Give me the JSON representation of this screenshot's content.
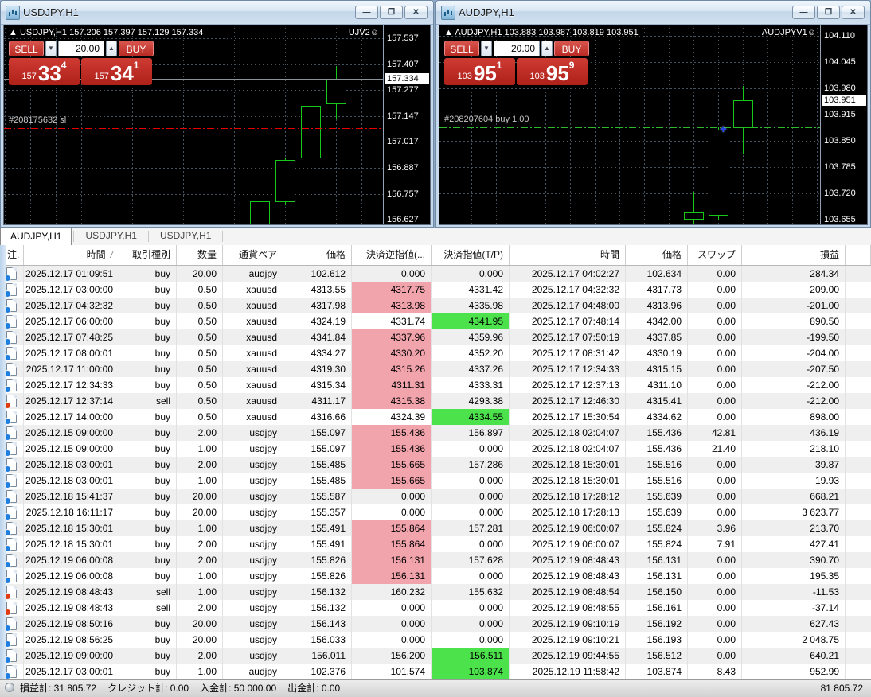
{
  "icons": {
    "minimize": "—",
    "restore": "❐",
    "close": "✕",
    "spin_down": "▼",
    "spin_up": "▲",
    "smiley": "☺",
    "collapse_arrow": "▲",
    "sort": "/",
    "move_cursor": "+"
  },
  "colors": {
    "candle": "#18c818",
    "sl_line": "#e80000",
    "buy_line": "#2eb82e",
    "current_line": "#8a929a",
    "pink_cell": "#f2a4ac",
    "green_cell": "#4ce24c",
    "button_red": "#c0392b"
  },
  "windows": [
    {
      "title": "USDJPY,H1",
      "chart_header": "USDJPY,H1 157.206 157.397 157.129 157.334",
      "ea_label": "UJV2",
      "panel": {
        "sell_label": "SELL",
        "buy_label": "BUY",
        "volume": "20.00",
        "sell_prefix": "157",
        "sell_big": "33",
        "sell_sup": "4",
        "buy_prefix": "157",
        "buy_big": "34",
        "buy_sup": "1"
      }
    },
    {
      "title": "AUDJPY,H1",
      "chart_header": "AUDJPY,H1 103.883 103.987 103.819 103.951",
      "ea_label": "AUDJPYV1",
      "panel": {
        "sell_label": "SELL",
        "buy_label": "BUY",
        "volume": "20.00",
        "sell_prefix": "103",
        "sell_big": "95",
        "sell_sup": "1",
        "buy_prefix": "103",
        "buy_big": "95",
        "buy_sup": "9"
      }
    }
  ],
  "chart_data": [
    {
      "type": "candlestick",
      "title": "USDJPY,H1",
      "last_bar_ohlc": {
        "open": 157.206,
        "high": 157.397,
        "low": 157.129,
        "close": 157.334
      },
      "ylim": [
        156.604,
        157.601
      ],
      "y_ticks": [
        157.537,
        157.407,
        157.277,
        157.147,
        157.017,
        156.887,
        156.757,
        156.627
      ],
      "current_price": 157.334,
      "grid": {
        "offset": 1,
        "step": 32
      },
      "candles": [
        {
          "x": 321,
          "o": 156.605,
          "h": 156.735,
          "l": 156.59,
          "c": 156.72
        },
        {
          "x": 353,
          "o": 156.715,
          "h": 156.94,
          "l": 156.7,
          "c": 156.928
        },
        {
          "x": 385,
          "o": 156.935,
          "h": 157.21,
          "l": 156.84,
          "c": 157.2
        },
        {
          "x": 417,
          "o": 157.206,
          "h": 157.397,
          "l": 157.129,
          "c": 157.334
        }
      ],
      "lines": [
        {
          "price": 157.334,
          "style": "solid",
          "color": "#8a929a",
          "label": ""
        },
        {
          "price": 157.087,
          "style": "dashdot",
          "color": "#e80000",
          "label": "#208175632 sl"
        }
      ]
    },
    {
      "type": "candlestick",
      "title": "AUDJPY,H1",
      "last_bar_ohlc": {
        "open": 103.883,
        "high": 103.987,
        "low": 103.819,
        "close": 103.951
      },
      "ylim": [
        103.644,
        104.136
      ],
      "y_ticks": [
        104.11,
        104.045,
        103.98,
        103.915,
        103.85,
        103.785,
        103.72,
        103.655
      ],
      "current_price": 103.951,
      "grid": {
        "offset": 9,
        "step": 31
      },
      "candles": [
        {
          "x": 319,
          "o": 103.655,
          "h": 103.725,
          "l": 103.647,
          "c": 103.673
        },
        {
          "x": 350,
          "o": 103.666,
          "h": 103.886,
          "l": 103.654,
          "c": 103.879
        },
        {
          "x": 381,
          "o": 103.883,
          "h": 103.987,
          "l": 103.819,
          "c": 103.951
        }
      ],
      "lines": [
        {
          "price": 103.885,
          "style": "dashdot",
          "color": "#2eb82e",
          "label": "#208207604 buy 1.00"
        }
      ],
      "cursor": {
        "x": 352,
        "y": 124
      }
    }
  ],
  "tabs": [
    {
      "label": "AUDJPY,H1",
      "active": true
    },
    {
      "label": "USDJPY,H1",
      "active": false
    },
    {
      "label": "USDJPY,H1",
      "active": false
    }
  ],
  "table": {
    "headers": [
      "注.",
      "時間",
      "取引種別",
      "数量",
      "通貨ペア",
      "価格",
      "決済逆指値(...",
      "決済指値(T/P)",
      "時間",
      "価格",
      "スワップ",
      "損益"
    ],
    "rows": [
      {
        "icon": "buy",
        "open_time": "2025.12.17 01:09:51",
        "type": "buy",
        "volume": "20.00",
        "symbol": "audjpy",
        "price": "102.612",
        "sl": "0.000",
        "tp": "0.000",
        "close_time": "2025.12.17 04:02:27",
        "close_price": "102.634",
        "swap": "0.00",
        "profit": "284.34",
        "sl_hl": "",
        "tp_hl": ""
      },
      {
        "icon": "buy",
        "open_time": "2025.12.17 03:00:00",
        "type": "buy",
        "volume": "0.50",
        "symbol": "xauusd",
        "price": "4313.55",
        "sl": "4317.75",
        "tp": "4331.42",
        "close_time": "2025.12.17 04:32:32",
        "close_price": "4317.73",
        "swap": "0.00",
        "profit": "209.00",
        "sl_hl": "pink",
        "tp_hl": ""
      },
      {
        "icon": "buy",
        "open_time": "2025.12.17 04:32:32",
        "type": "buy",
        "volume": "0.50",
        "symbol": "xauusd",
        "price": "4317.98",
        "sl": "4313.98",
        "tp": "4335.98",
        "close_time": "2025.12.17 04:48:00",
        "close_price": "4313.96",
        "swap": "0.00",
        "profit": "-201.00",
        "sl_hl": "pink",
        "tp_hl": ""
      },
      {
        "icon": "buy",
        "open_time": "2025.12.17 06:00:00",
        "type": "buy",
        "volume": "0.50",
        "symbol": "xauusd",
        "price": "4324.19",
        "sl": "4331.74",
        "tp": "4341.95",
        "close_time": "2025.12.17 07:48:14",
        "close_price": "4342.00",
        "swap": "0.00",
        "profit": "890.50",
        "sl_hl": "",
        "tp_hl": "green"
      },
      {
        "icon": "buy",
        "open_time": "2025.12.17 07:48:25",
        "type": "buy",
        "volume": "0.50",
        "symbol": "xauusd",
        "price": "4341.84",
        "sl": "4337.96",
        "tp": "4359.96",
        "close_time": "2025.12.17 07:50:19",
        "close_price": "4337.85",
        "swap": "0.00",
        "profit": "-199.50",
        "sl_hl": "pink",
        "tp_hl": ""
      },
      {
        "icon": "buy",
        "open_time": "2025.12.17 08:00:01",
        "type": "buy",
        "volume": "0.50",
        "symbol": "xauusd",
        "price": "4334.27",
        "sl": "4330.20",
        "tp": "4352.20",
        "close_time": "2025.12.17 08:31:42",
        "close_price": "4330.19",
        "swap": "0.00",
        "profit": "-204.00",
        "sl_hl": "pink",
        "tp_hl": ""
      },
      {
        "icon": "buy",
        "open_time": "2025.12.17 11:00:00",
        "type": "buy",
        "volume": "0.50",
        "symbol": "xauusd",
        "price": "4319.30",
        "sl": "4315.26",
        "tp": "4337.26",
        "close_time": "2025.12.17 12:34:33",
        "close_price": "4315.15",
        "swap": "0.00",
        "profit": "-207.50",
        "sl_hl": "pink",
        "tp_hl": ""
      },
      {
        "icon": "buy",
        "open_time": "2025.12.17 12:34:33",
        "type": "buy",
        "volume": "0.50",
        "symbol": "xauusd",
        "price": "4315.34",
        "sl": "4311.31",
        "tp": "4333.31",
        "close_time": "2025.12.17 12:37:13",
        "close_price": "4311.10",
        "swap": "0.00",
        "profit": "-212.00",
        "sl_hl": "pink",
        "tp_hl": ""
      },
      {
        "icon": "sell",
        "open_time": "2025.12.17 12:37:14",
        "type": "sell",
        "volume": "0.50",
        "symbol": "xauusd",
        "price": "4311.17",
        "sl": "4315.38",
        "tp": "4293.38",
        "close_time": "2025.12.17 12:46:30",
        "close_price": "4315.41",
        "swap": "0.00",
        "profit": "-212.00",
        "sl_hl": "pink",
        "tp_hl": ""
      },
      {
        "icon": "buy",
        "open_time": "2025.12.17 14:00:00",
        "type": "buy",
        "volume": "0.50",
        "symbol": "xauusd",
        "price": "4316.66",
        "sl": "4324.39",
        "tp": "4334.55",
        "close_time": "2025.12.17 15:30:54",
        "close_price": "4334.62",
        "swap": "0.00",
        "profit": "898.00",
        "sl_hl": "",
        "tp_hl": "green"
      },
      {
        "icon": "buy",
        "open_time": "2025.12.15 09:00:00",
        "type": "buy",
        "volume": "2.00",
        "symbol": "usdjpy",
        "price": "155.097",
        "sl": "155.436",
        "tp": "156.897",
        "close_time": "2025.12.18 02:04:07",
        "close_price": "155.436",
        "swap": "42.81",
        "profit": "436.19",
        "sl_hl": "pink",
        "tp_hl": ""
      },
      {
        "icon": "buy",
        "open_time": "2025.12.15 09:00:00",
        "type": "buy",
        "volume": "1.00",
        "symbol": "usdjpy",
        "price": "155.097",
        "sl": "155.436",
        "tp": "0.000",
        "close_time": "2025.12.18 02:04:07",
        "close_price": "155.436",
        "swap": "21.40",
        "profit": "218.10",
        "sl_hl": "pink",
        "tp_hl": ""
      },
      {
        "icon": "buy",
        "open_time": "2025.12.18 03:00:01",
        "type": "buy",
        "volume": "2.00",
        "symbol": "usdjpy",
        "price": "155.485",
        "sl": "155.665",
        "tp": "157.286",
        "close_time": "2025.12.18 15:30:01",
        "close_price": "155.516",
        "swap": "0.00",
        "profit": "39.87",
        "sl_hl": "pink",
        "tp_hl": ""
      },
      {
        "icon": "buy",
        "open_time": "2025.12.18 03:00:01",
        "type": "buy",
        "volume": "1.00",
        "symbol": "usdjpy",
        "price": "155.485",
        "sl": "155.665",
        "tp": "0.000",
        "close_time": "2025.12.18 15:30:01",
        "close_price": "155.516",
        "swap": "0.00",
        "profit": "19.93",
        "sl_hl": "pink",
        "tp_hl": ""
      },
      {
        "icon": "buy",
        "open_time": "2025.12.18 15:41:37",
        "type": "buy",
        "volume": "20.00",
        "symbol": "usdjpy",
        "price": "155.587",
        "sl": "0.000",
        "tp": "0.000",
        "close_time": "2025.12.18 17:28:12",
        "close_price": "155.639",
        "swap": "0.00",
        "profit": "668.21",
        "sl_hl": "",
        "tp_hl": ""
      },
      {
        "icon": "buy",
        "open_time": "2025.12.18 16:11:17",
        "type": "buy",
        "volume": "20.00",
        "symbol": "usdjpy",
        "price": "155.357",
        "sl": "0.000",
        "tp": "0.000",
        "close_time": "2025.12.18 17:28:13",
        "close_price": "155.639",
        "swap": "0.00",
        "profit": "3 623.77",
        "sl_hl": "",
        "tp_hl": ""
      },
      {
        "icon": "buy",
        "open_time": "2025.12.18 15:30:01",
        "type": "buy",
        "volume": "1.00",
        "symbol": "usdjpy",
        "price": "155.491",
        "sl": "155.864",
        "tp": "157.281",
        "close_time": "2025.12.19 06:00:07",
        "close_price": "155.824",
        "swap": "3.96",
        "profit": "213.70",
        "sl_hl": "pink",
        "tp_hl": ""
      },
      {
        "icon": "buy",
        "open_time": "2025.12.18 15:30:01",
        "type": "buy",
        "volume": "2.00",
        "symbol": "usdjpy",
        "price": "155.491",
        "sl": "155.864",
        "tp": "0.000",
        "close_time": "2025.12.19 06:00:07",
        "close_price": "155.824",
        "swap": "7.91",
        "profit": "427.41",
        "sl_hl": "pink",
        "tp_hl": ""
      },
      {
        "icon": "buy",
        "open_time": "2025.12.19 06:00:08",
        "type": "buy",
        "volume": "2.00",
        "symbol": "usdjpy",
        "price": "155.826",
        "sl": "156.131",
        "tp": "157.628",
        "close_time": "2025.12.19 08:48:43",
        "close_price": "156.131",
        "swap": "0.00",
        "profit": "390.70",
        "sl_hl": "pink",
        "tp_hl": ""
      },
      {
        "icon": "buy",
        "open_time": "2025.12.19 06:00:08",
        "type": "buy",
        "volume": "1.00",
        "symbol": "usdjpy",
        "price": "155.826",
        "sl": "156.131",
        "tp": "0.000",
        "close_time": "2025.12.19 08:48:43",
        "close_price": "156.131",
        "swap": "0.00",
        "profit": "195.35",
        "sl_hl": "pink",
        "tp_hl": ""
      },
      {
        "icon": "sell",
        "open_time": "2025.12.19 08:48:43",
        "type": "sell",
        "volume": "1.00",
        "symbol": "usdjpy",
        "price": "156.132",
        "sl": "160.232",
        "tp": "155.632",
        "close_time": "2025.12.19 08:48:54",
        "close_price": "156.150",
        "swap": "0.00",
        "profit": "-11.53",
        "sl_hl": "",
        "tp_hl": ""
      },
      {
        "icon": "sell",
        "open_time": "2025.12.19 08:48:43",
        "type": "sell",
        "volume": "2.00",
        "symbol": "usdjpy",
        "price": "156.132",
        "sl": "0.000",
        "tp": "0.000",
        "close_time": "2025.12.19 08:48:55",
        "close_price": "156.161",
        "swap": "0.00",
        "profit": "-37.14",
        "sl_hl": "",
        "tp_hl": ""
      },
      {
        "icon": "buy",
        "open_time": "2025.12.19 08:50:16",
        "type": "buy",
        "volume": "20.00",
        "symbol": "usdjpy",
        "price": "156.143",
        "sl": "0.000",
        "tp": "0.000",
        "close_time": "2025.12.19 09:10:19",
        "close_price": "156.192",
        "swap": "0.00",
        "profit": "627.43",
        "sl_hl": "",
        "tp_hl": ""
      },
      {
        "icon": "buy",
        "open_time": "2025.12.19 08:56:25",
        "type": "buy",
        "volume": "20.00",
        "symbol": "usdjpy",
        "price": "156.033",
        "sl": "0.000",
        "tp": "0.000",
        "close_time": "2025.12.19 09:10:21",
        "close_price": "156.193",
        "swap": "0.00",
        "profit": "2 048.75",
        "sl_hl": "",
        "tp_hl": ""
      },
      {
        "icon": "buy",
        "open_time": "2025.12.19 09:00:00",
        "type": "buy",
        "volume": "2.00",
        "symbol": "usdjpy",
        "price": "156.011",
        "sl": "156.200",
        "tp": "156.511",
        "close_time": "2025.12.19 09:44:55",
        "close_price": "156.512",
        "swap": "0.00",
        "profit": "640.21",
        "sl_hl": "",
        "tp_hl": "green"
      },
      {
        "icon": "buy",
        "open_time": "2025.12.17 03:00:01",
        "type": "buy",
        "volume": "1.00",
        "symbol": "audjpy",
        "price": "102.376",
        "sl": "101.574",
        "tp": "103.874",
        "close_time": "2025.12.19 11:58:42",
        "close_price": "103.874",
        "swap": "8.43",
        "profit": "952.99",
        "sl_hl": "",
        "tp_hl": "green"
      }
    ]
  },
  "status_bar": {
    "items": [
      "損益計: 31 805.72",
      "クレジット計: 0.00",
      "入金計: 50 000.00",
      "出金計: 0.00"
    ],
    "balance": "81 805.72"
  }
}
